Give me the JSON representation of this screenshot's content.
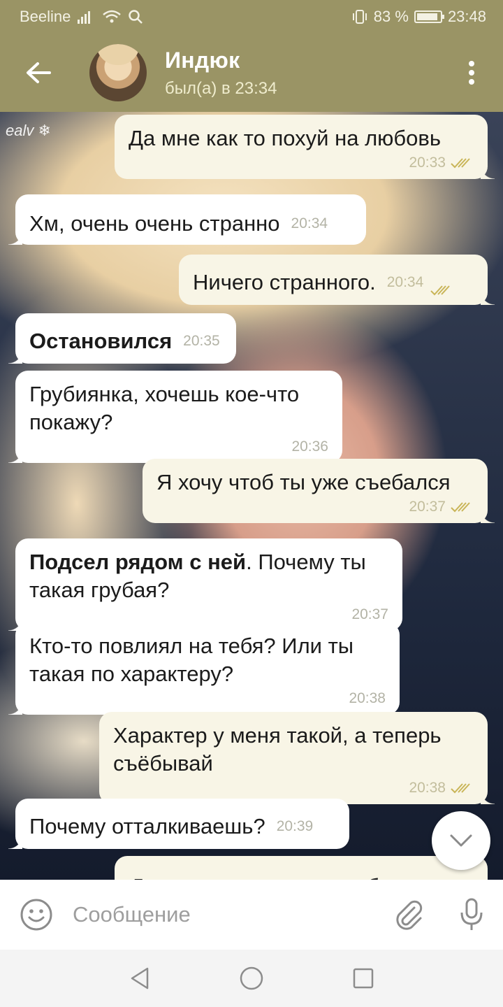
{
  "status_bar": {
    "carrier": "Beeline",
    "battery_percent": "83 %",
    "time": "23:48",
    "icons": [
      "signal-icon",
      "wifi-icon",
      "search-icon",
      "vibrate-icon",
      "battery-icon"
    ]
  },
  "header": {
    "name": "Индюк",
    "last_seen": "был(а) в 23:34"
  },
  "wallpaper": {
    "signature": "ealv ❄"
  },
  "messages": [
    {
      "dir": "out",
      "text": "Да мне как то похуй на любовь",
      "time": "20:33"
    },
    {
      "dir": "in",
      "text": "Хм, очень очень странно",
      "time": "20:34"
    },
    {
      "dir": "out",
      "text": "Ничего странного.",
      "time": "20:34"
    },
    {
      "dir": "in",
      "bold": "Остановился",
      "text": "",
      "time": "20:35"
    },
    {
      "dir": "in",
      "text": "Грубиянка, хочешь кое-что покажу?",
      "time": "20:36"
    },
    {
      "dir": "out",
      "text": "Я хочу чтоб ты уже съебался",
      "time": "20:37"
    },
    {
      "dir": "in",
      "bold": "Подсел рядом с ней",
      "text": ". Почему ты такая грубая?",
      "time": "20:37"
    },
    {
      "dir": "in",
      "text": "Кто-то повлиял на тебя? Или ты такая по характеру?",
      "time": "20:38"
    },
    {
      "dir": "out",
      "text": "Характер у меня такой, а теперь съёбывай",
      "time": "20:38"
    },
    {
      "dir": "in",
      "text": "Почему отталкиваешь?",
      "time": "20:39"
    },
    {
      "dir": "out",
      "text": "Да потому что ты меня бесишь",
      "time": ""
    }
  ],
  "input": {
    "placeholder": "Сообщение"
  },
  "colors": {
    "header_bg": "#9a9465",
    "incoming_bubble": "#ffffff",
    "outgoing_bubble": "#f8f5e6",
    "read_ticks": "#c9b558"
  }
}
